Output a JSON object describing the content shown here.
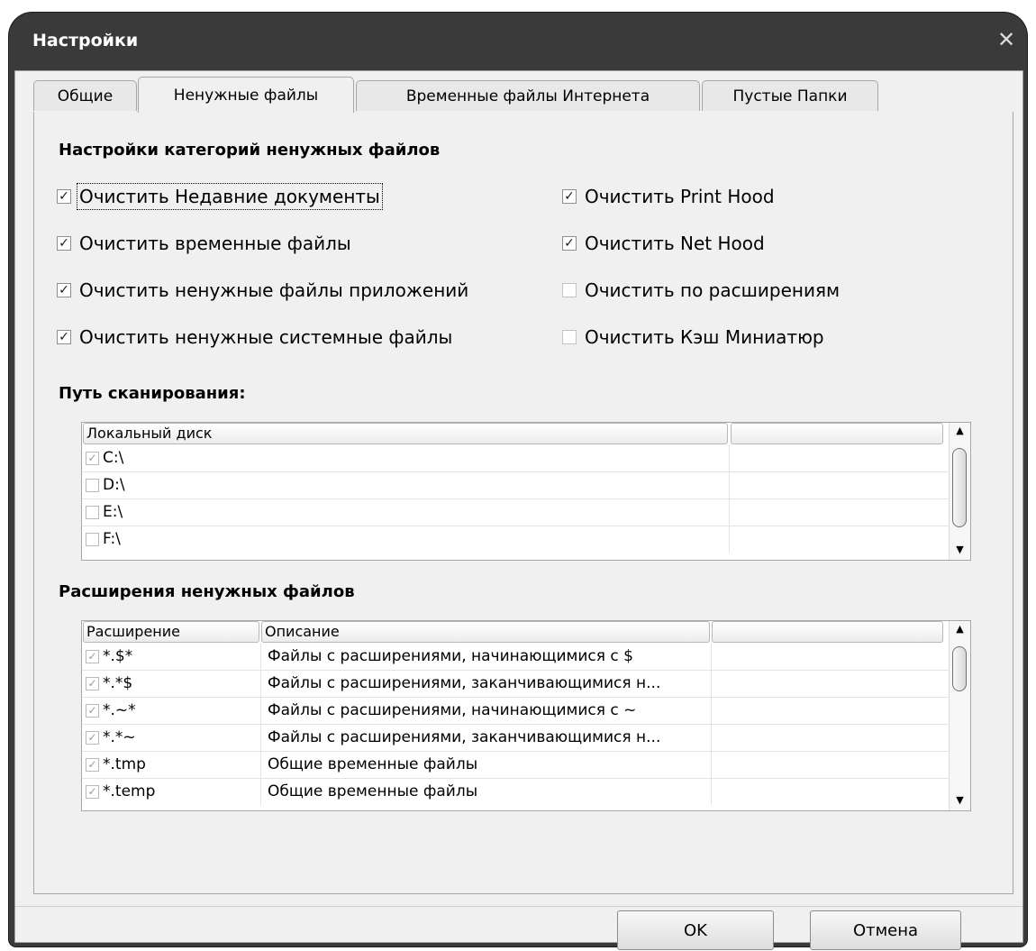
{
  "window": {
    "title": "Настройки",
    "close_glyph": "✕"
  },
  "tabs": [
    {
      "label": "Общие"
    },
    {
      "label": "Ненужные файлы"
    },
    {
      "label": "Временные файлы Интернета"
    },
    {
      "label": "Пустые Папки"
    }
  ],
  "active_tab": "Ненужные файлы",
  "categories": {
    "title": "Настройки категорий ненужных файлов",
    "left": [
      {
        "label": "Очистить Недавние документы",
        "checked": true
      },
      {
        "label": "Очистить временные файлы",
        "checked": true
      },
      {
        "label": "Очистить ненужные файлы приложений",
        "checked": true
      },
      {
        "label": "Очистить ненужные системные файлы",
        "checked": true
      }
    ],
    "right": [
      {
        "label": "Очистить Print Hood",
        "checked": true
      },
      {
        "label": "Очистить Net Hood",
        "checked": true
      },
      {
        "label": "Очистить по расширениям",
        "checked": false
      },
      {
        "label": "Очистить Кэш Миниатюр",
        "checked": false
      }
    ]
  },
  "scan_path": {
    "title": "Путь сканирования:",
    "header": "Локальный диск",
    "rows": [
      {
        "label": "C:\\",
        "checked": true
      },
      {
        "label": "D:\\",
        "checked": false
      },
      {
        "label": "E:\\",
        "checked": false
      },
      {
        "label": "F:\\",
        "checked": false
      }
    ]
  },
  "extensions": {
    "title": "Расширения ненужных файлов",
    "headers": {
      "ext": "Расширение",
      "desc": "Описание"
    },
    "rows": [
      {
        "ext": "*.$*",
        "desc": "Файлы с расширениями, начинающимися с $",
        "checked": true
      },
      {
        "ext": "*.*$",
        "desc": "Файлы с расширениями, заканчивающимися н...",
        "checked": true
      },
      {
        "ext": "*.~*",
        "desc": "Файлы с расширениями, начинающимися с ~",
        "checked": true
      },
      {
        "ext": "*.*~",
        "desc": "Файлы с расширениями, заканчивающимися н...",
        "checked": true
      },
      {
        "ext": "*.tmp",
        "desc": "Общие временные файлы",
        "checked": true
      },
      {
        "ext": "*.temp",
        "desc": "Общие временные файлы",
        "checked": true
      }
    ]
  },
  "buttons": {
    "ok": "OK",
    "cancel": "Отмена"
  },
  "glyphs": {
    "check": "✓",
    "scroll_up": "▲",
    "scroll_down": "▼"
  },
  "colors": {
    "title_bar": "#3a3a3a",
    "client_bg": "#f0f0f0"
  }
}
